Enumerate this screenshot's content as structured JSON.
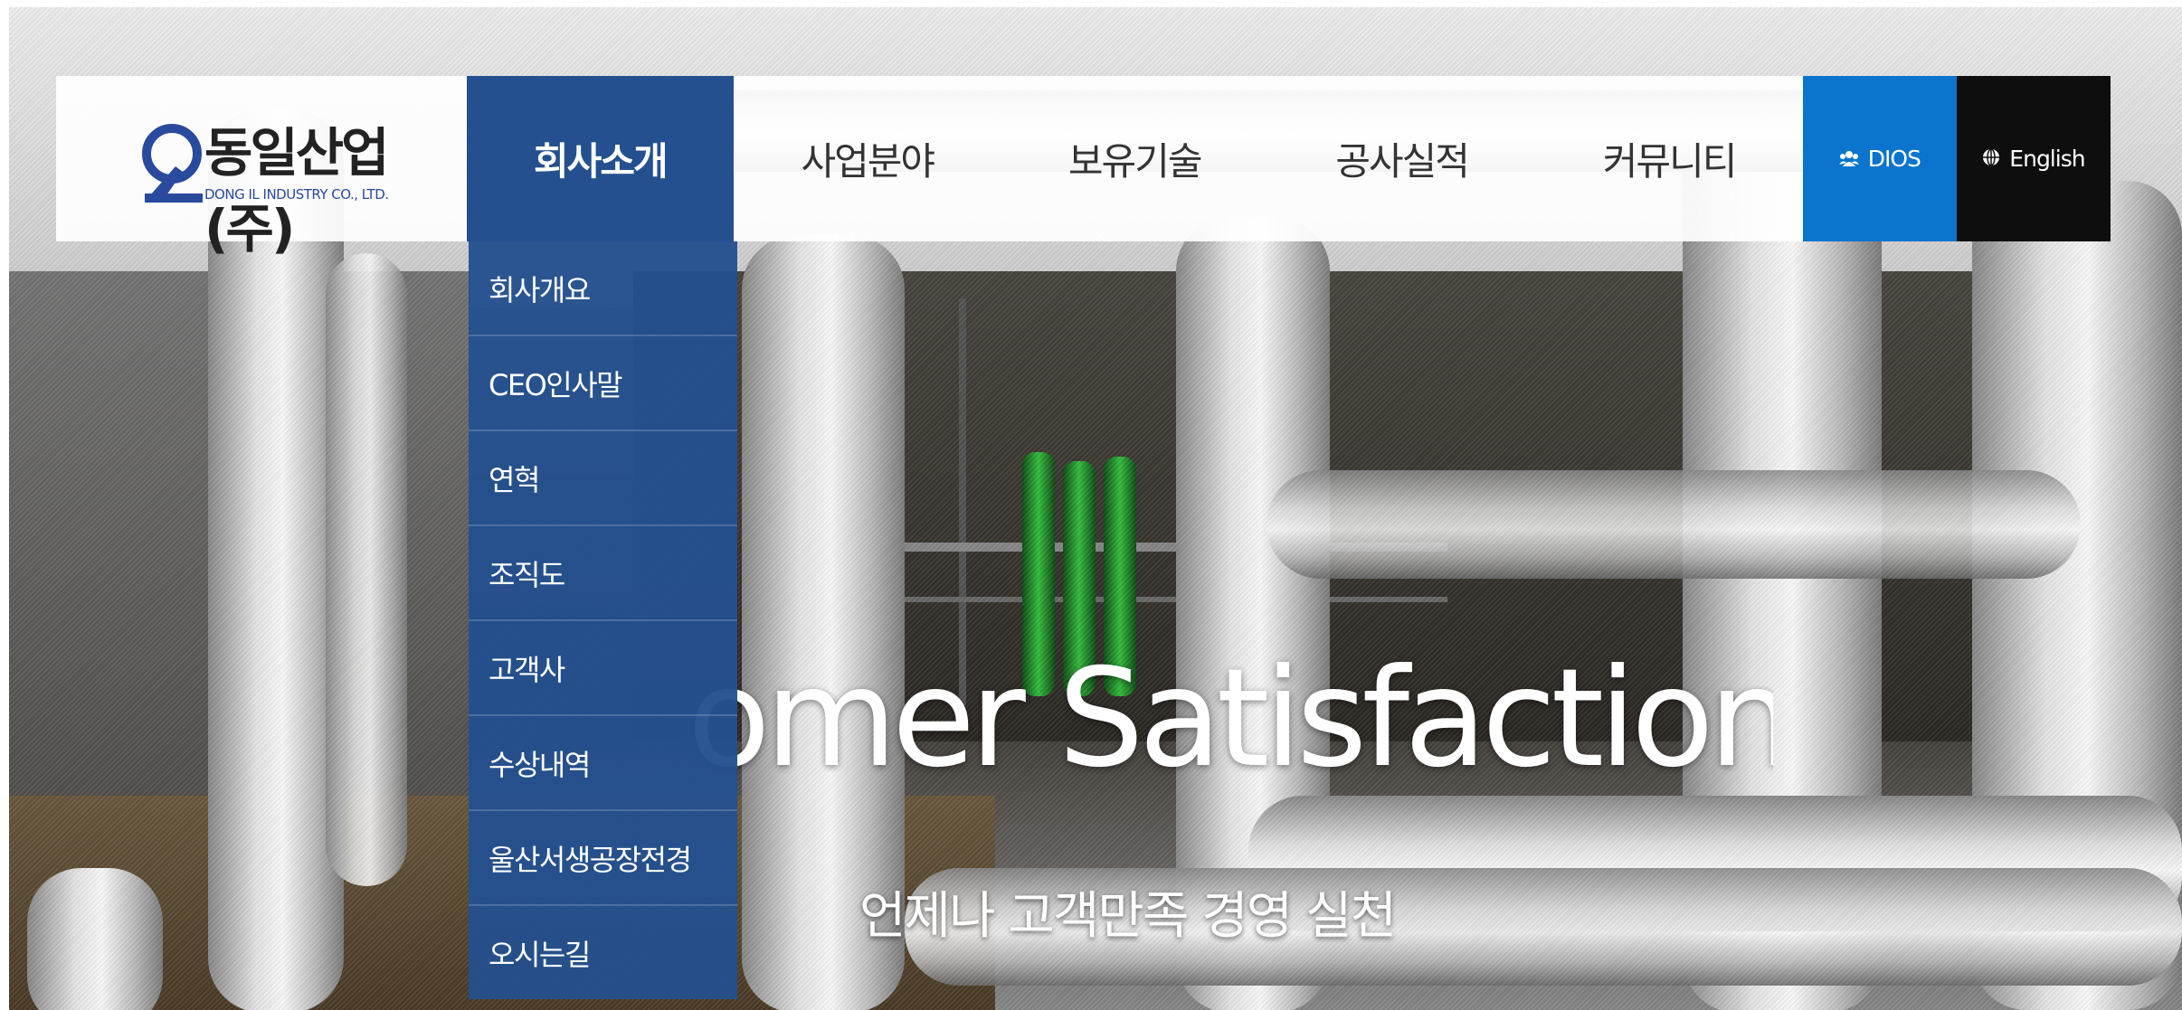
{
  "brand": {
    "name_ko": "동일산업(주)",
    "name_en": "DONG IL INDUSTRY CO., LTD.",
    "logo_icon": "dongil-logo-icon",
    "accent_color": "#24508f"
  },
  "nav": {
    "items": [
      {
        "label": "회사소개",
        "active": true
      },
      {
        "label": "사업분야",
        "active": false
      },
      {
        "label": "보유기술",
        "active": false
      },
      {
        "label": "공사실적",
        "active": false
      },
      {
        "label": "커뮤니티",
        "active": false
      }
    ],
    "dios_label": "DIOS",
    "dios_icon": "users-icon",
    "dios_color": "#0b74cc",
    "english_label": "English",
    "english_icon": "globe-icon",
    "english_color": "#0e0e0e"
  },
  "submenu": {
    "items": [
      "회사개요",
      "CEO인사말",
      "연혁",
      "조직도",
      "고객사",
      "수상내역",
      "울산서생공장전경",
      "오시는길"
    ]
  },
  "hero": {
    "headline": "omer Satisfaction",
    "subheadline": "언제나 고객만족 경영 실천"
  }
}
